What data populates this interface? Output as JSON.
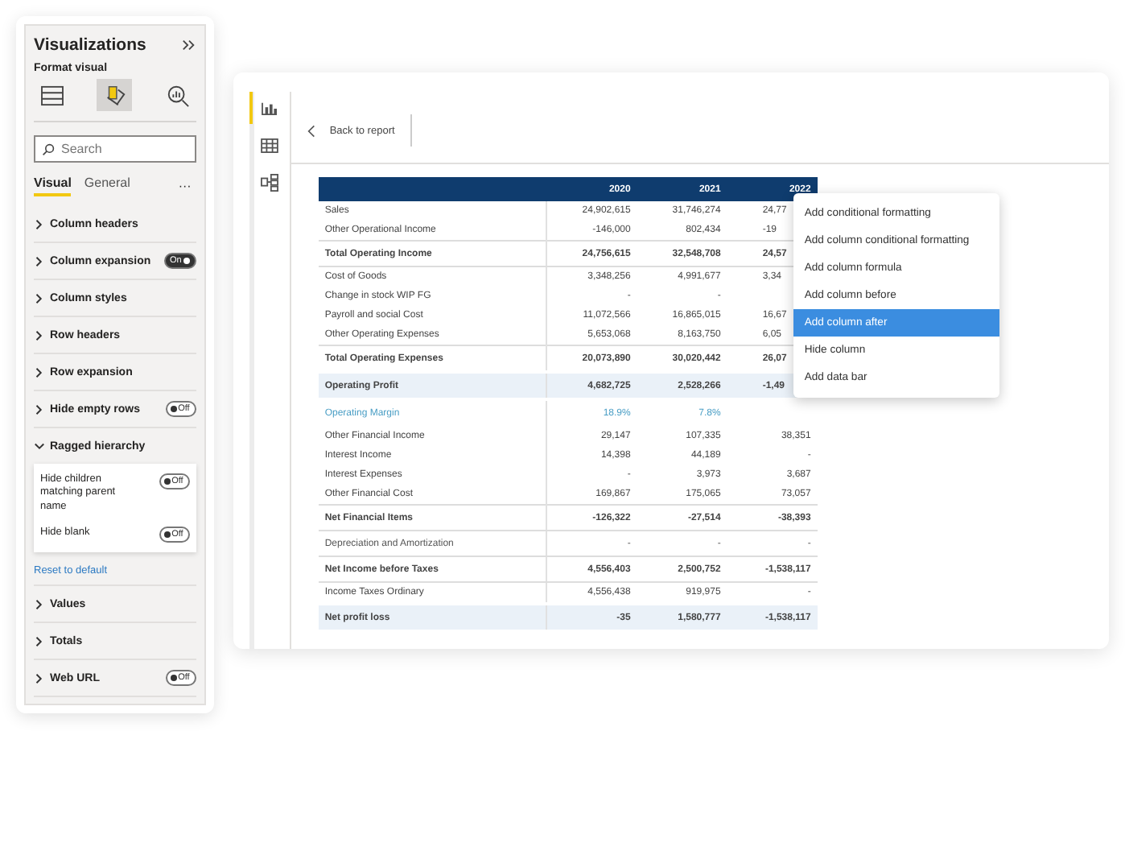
{
  "panel": {
    "title": "Visualizations",
    "subtitle": "Format visual",
    "views": [
      {
        "selected": false
      },
      {
        "selected": true
      },
      {
        "selected": false
      }
    ],
    "search": {
      "placeholder": "Search"
    },
    "tabs": [
      {
        "label": "Visual",
        "selected": true
      },
      {
        "label": "General",
        "selected": false
      }
    ],
    "more": "···",
    "sections": [
      {
        "label": "Column headers",
        "expanded": false
      },
      {
        "label": "Column expansion",
        "expanded": false,
        "toggle": {
          "on": true,
          "text": "On"
        }
      },
      {
        "label": "Column styles",
        "expanded": false
      },
      {
        "label": "Row headers",
        "expanded": false
      },
      {
        "label": "Row expansion",
        "expanded": false
      },
      {
        "label": "Hide empty rows",
        "expanded": false,
        "toggle": {
          "on": false,
          "text": "Off"
        }
      },
      {
        "label": "Ragged hierarchy",
        "expanded": true,
        "options": [
          {
            "label": "Hide children matching parent name",
            "toggle": {
              "on": false,
              "text": "Off"
            }
          },
          {
            "label": "Hide blank",
            "toggle": {
              "on": false,
              "text": "Off"
            }
          }
        ],
        "reset": "Reset to default"
      },
      {
        "label": "Values",
        "expanded": false
      },
      {
        "label": "Totals",
        "expanded": false
      },
      {
        "label": "Web URL",
        "expanded": false,
        "toggle": {
          "on": false,
          "text": "Off"
        }
      }
    ]
  },
  "report": {
    "rail": [
      {
        "selected": true
      },
      {
        "selected": false
      },
      {
        "selected": false
      }
    ],
    "back": "Back to report",
    "table": {
      "columns": [
        "2020",
        "2021",
        "2022"
      ],
      "rows": [
        {
          "kind": "normal",
          "label": "Sales",
          "cells": [
            "24,902,615",
            "31,746,274",
            "24,77"
          ],
          "cut": true
        },
        {
          "kind": "normal",
          "label": "Other Operational Income",
          "cells": [
            "-146,000",
            "802,434",
            "-19"
          ],
          "cut": true
        },
        {
          "kind": "total",
          "label": "Total Operating Income",
          "cells": [
            "24,756,615",
            "32,548,708",
            "24,57"
          ],
          "cut": true
        },
        {
          "kind": "normal",
          "label": "Cost of Goods",
          "cells": [
            "3,348,256",
            "4,991,677",
            "3,34"
          ],
          "cut": true
        },
        {
          "kind": "normal",
          "label": "Change in stock WIP FG",
          "cells": [
            "-",
            "-",
            null
          ]
        },
        {
          "kind": "normal",
          "label": "Payroll and social Cost",
          "cells": [
            "11,072,566",
            "16,865,015",
            "16,67"
          ],
          "cut": true
        },
        {
          "kind": "normal",
          "label": "Other Operating Expenses",
          "cells": [
            "5,653,068",
            "8,163,750",
            "6,05"
          ],
          "cut": true
        },
        {
          "kind": "total",
          "label": "Total Operating Expenses",
          "cells": [
            "20,073,890",
            "30,020,442",
            "26,07"
          ],
          "cut": true
        },
        {
          "kind": "highlight",
          "label": "Operating Profit",
          "cells": [
            "4,682,725",
            "2,528,266",
            "-1,49"
          ],
          "cut": true
        },
        {
          "kind": "margin",
          "label": "Operating Margin",
          "cells": [
            "18.9%",
            "7.8%",
            null
          ]
        },
        {
          "kind": "normal",
          "label": "Other Financial Income",
          "cells": [
            "29,147",
            "107,335",
            "38,351"
          ]
        },
        {
          "kind": "normal",
          "label": "Interest Income",
          "cells": [
            "14,398",
            "44,189",
            "-"
          ]
        },
        {
          "kind": "normal",
          "label": "Interest Expenses",
          "cells": [
            "-",
            "3,973",
            "3,687"
          ]
        },
        {
          "kind": "normal",
          "label": "Other Financial Cost",
          "cells": [
            "169,867",
            "175,065",
            "73,057"
          ]
        },
        {
          "kind": "total",
          "label": "Net Financial Items",
          "cells": [
            "-126,322",
            "-27,514",
            "-38,393"
          ]
        },
        {
          "kind": "divided",
          "label": "Depreciation and Amortization",
          "cells": [
            "-",
            "-",
            "-"
          ]
        },
        {
          "kind": "total",
          "label": "Net Income before Taxes",
          "cells": [
            "4,556,403",
            "2,500,752",
            "-1,538,117"
          ]
        },
        {
          "kind": "normal",
          "label": "Income Taxes Ordinary",
          "cells": [
            "4,556,438",
            "919,975",
            "-"
          ]
        },
        {
          "kind": "highlight",
          "label": "Net profit loss",
          "cells": [
            "-35",
            "1,580,777",
            "-1,538,117"
          ]
        }
      ]
    },
    "menu": [
      {
        "label": "Add conditional formatting",
        "selected": false
      },
      {
        "label": "Add column conditional formatting",
        "selected": false
      },
      {
        "label": "Add column formula",
        "selected": false
      },
      {
        "label": "Add column before",
        "selected": false
      },
      {
        "label": "Add column after",
        "selected": true
      },
      {
        "label": "Hide column",
        "selected": false
      },
      {
        "label": "Add data bar",
        "selected": false
      }
    ]
  }
}
